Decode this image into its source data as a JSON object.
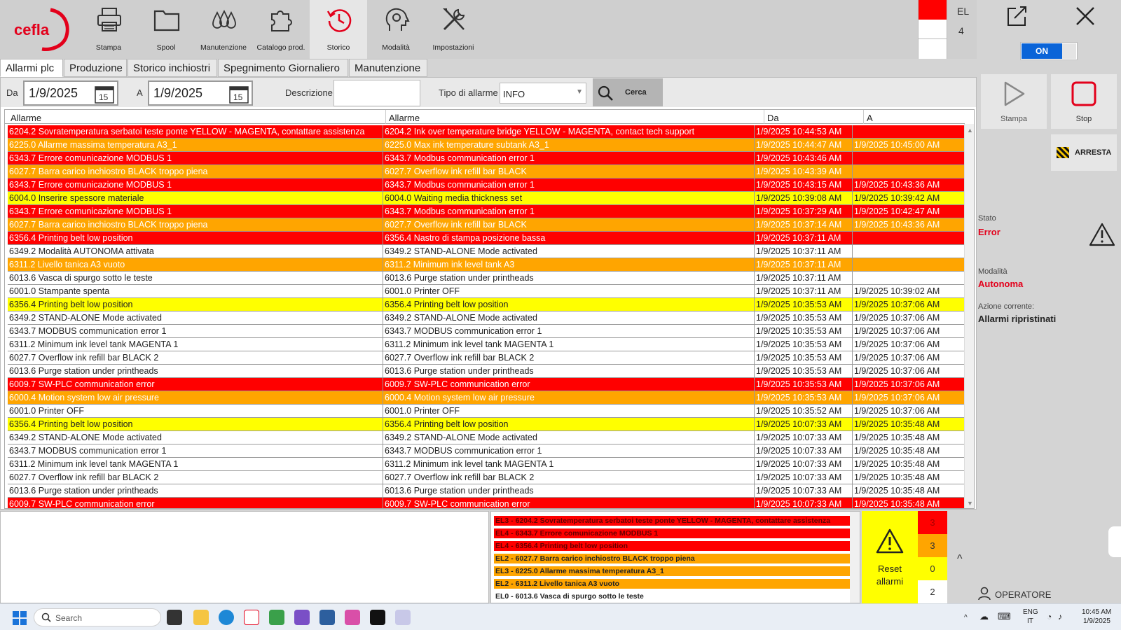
{
  "app": {
    "logo_text": "cefla",
    "toolbar": [
      {
        "id": "stampa",
        "label": "Stampa",
        "icon": "printer-icon"
      },
      {
        "id": "spool",
        "label": "Spool",
        "icon": "folder-icon"
      },
      {
        "id": "manutenzione",
        "label": "Manutenzione",
        "icon": "drops-icon"
      },
      {
        "id": "catalogo",
        "label": "Catalogo prod.",
        "icon": "puzzle-icon"
      },
      {
        "id": "storico",
        "label": "Storico",
        "icon": "history-icon",
        "active": true
      },
      {
        "id": "modalita",
        "label": "Modalità",
        "icon": "gear-head-icon"
      },
      {
        "id": "impostazioni",
        "label": "Impostazioni",
        "icon": "tools-icon"
      }
    ],
    "el_label": "EL",
    "el_value": "4"
  },
  "tabs": [
    {
      "label": "Allarmi plc",
      "active": true
    },
    {
      "label": "Produzione"
    },
    {
      "label": "Storico inchiostri"
    },
    {
      "label": "Spegnimento Giornaliero"
    },
    {
      "label": "Manutenzione"
    }
  ],
  "filter": {
    "da_label": "Da",
    "da_value": "1/9/2025",
    "a_label": "A",
    "a_value": "1/9/2025",
    "calendar_day": "15",
    "descrizione_label": "Descrizione",
    "descrizione_value": "",
    "tipo_label": "Tipo di allarme",
    "tipo_value": "INFO",
    "cerca_label": "Cerca"
  },
  "grid": {
    "headers": [
      "Allarme",
      "Allarme",
      "Da",
      "A"
    ],
    "rows": [
      {
        "c": "red",
        "it": "6204.2  Sovratemperatura serbatoi teste ponte YELLOW - MAGENTA, contattare assistenza",
        "en": "6204.2  Ink over temperature bridge YELLOW - MAGENTA, contact tech support",
        "da": "1/9/2025 10:44:53 AM",
        "a": ""
      },
      {
        "c": "orange",
        "it": "6225.0   Allarme massima temperatura A3_1",
        "en": "6225.0   Max ink temperature subtank A3_1",
        "da": "1/9/2025 10:44:47 AM",
        "a": "1/9/2025 10:45:00 AM"
      },
      {
        "c": "red",
        "it": "6343.7   Errore comunicazione MODBUS 1",
        "en": "6343.7   Modbus communication error 1",
        "da": "1/9/2025 10:43:46 AM",
        "a": ""
      },
      {
        "c": "orange",
        "it": "6027.7   Barra carico inchiostro BLACK troppo piena",
        "en": "6027.7   Overflow ink refill bar BLACK",
        "da": "1/9/2025 10:43:39 AM",
        "a": ""
      },
      {
        "c": "red",
        "it": "6343.7   Errore comunicazione MODBUS 1",
        "en": "6343.7   Modbus communication error 1",
        "da": "1/9/2025 10:43:15 AM",
        "a": "1/9/2025 10:43:36 AM"
      },
      {
        "c": "yellow",
        "it": "6004.0  Inserire spessore materiale",
        "en": "6004.0  Waiting media thickness set",
        "da": "1/9/2025 10:39:08 AM",
        "a": "1/9/2025 10:39:42 AM"
      },
      {
        "c": "red",
        "it": "6343.7   Errore comunicazione MODBUS 1",
        "en": "6343.7   Modbus communication error 1",
        "da": "1/9/2025 10:37:29 AM",
        "a": "1/9/2025 10:42:47 AM"
      },
      {
        "c": "orange",
        "it": "6027.7   Barra carico inchiostro BLACK troppo piena",
        "en": "6027.7   Overflow ink refill bar BLACK",
        "da": "1/9/2025 10:37:14 AM",
        "a": "1/9/2025 10:43:36 AM"
      },
      {
        "c": "red",
        "it": "6356.4 Printing belt low position",
        "en": "6356.4 Nastro di stampa posizione bassa",
        "da": "1/9/2025 10:37:11 AM",
        "a": ""
      },
      {
        "c": "white",
        "it": "6349.2   Modalità AUTONOMA attivata",
        "en": "6349.2   STAND-ALONE Mode activated",
        "da": "1/9/2025 10:37:11 AM",
        "a": ""
      },
      {
        "c": "orange",
        "it": "6311.2   Livello tanica A3 vuoto",
        "en": "6311.2   Minimum ink level tank A3",
        "da": "1/9/2025 10:37:11 AM",
        "a": ""
      },
      {
        "c": "white",
        "it": "6013.6   Vasca di spurgo sotto le teste",
        "en": "6013.6   Purge station under printheads",
        "da": "1/9/2025 10:37:11 AM",
        "a": ""
      },
      {
        "c": "white",
        "it": "6001.0   Stampante spenta",
        "en": "6001.0   Printer OFF",
        "da": "1/9/2025 10:37:11 AM",
        "a": "1/9/2025 10:39:02 AM"
      },
      {
        "c": "yellow",
        "it": "6356.4 Printing belt low position",
        "en": "6356.4 Printing belt low position",
        "da": "1/9/2025 10:35:53 AM",
        "a": "1/9/2025 10:37:06 AM"
      },
      {
        "c": "white",
        "it": "6349.2  STAND-ALONE Mode activated",
        "en": "6349.2  STAND-ALONE Mode activated",
        "da": "1/9/2025 10:35:53 AM",
        "a": "1/9/2025 10:37:06 AM"
      },
      {
        "c": "white",
        "it": "6343.7  MODBUS communication error 1",
        "en": "6343.7  MODBUS communication error 1",
        "da": "1/9/2025 10:35:53 AM",
        "a": "1/9/2025 10:37:06 AM"
      },
      {
        "c": "white",
        "it": "6311.2  Minimum ink level tank MAGENTA 1",
        "en": "6311.2  Minimum ink level tank MAGENTA 1",
        "da": "1/9/2025 10:35:53 AM",
        "a": "1/9/2025 10:37:06 AM"
      },
      {
        "c": "white",
        "it": "6027.7  Overflow ink refill bar BLACK 2",
        "en": "6027.7  Overflow ink refill bar BLACK 2",
        "da": "1/9/2025 10:35:53 AM",
        "a": "1/9/2025 10:37:06 AM"
      },
      {
        "c": "white",
        "it": "6013.6  Purge station under printheads",
        "en": "6013.6  Purge station under printheads",
        "da": "1/9/2025 10:35:53 AM",
        "a": "1/9/2025 10:37:06 AM"
      },
      {
        "c": "red",
        "it": "6009.7  SW-PLC communication error",
        "en": "6009.7  SW-PLC communication error",
        "da": "1/9/2025 10:35:53 AM",
        "a": "1/9/2025 10:37:06 AM"
      },
      {
        "c": "orange",
        "it": "6000.4 Motion system low air pressure",
        "en": "6000.4 Motion system low air pressure",
        "da": "1/9/2025 10:35:53 AM",
        "a": "1/9/2025 10:37:06 AM"
      },
      {
        "c": "white",
        "it": "6001.0  Printer OFF",
        "en": "6001.0  Printer OFF",
        "da": "1/9/2025 10:35:52 AM",
        "a": "1/9/2025 10:37:06 AM"
      },
      {
        "c": "yellow",
        "it": "6356.4 Printing belt low position",
        "en": "6356.4 Printing belt low position",
        "da": "1/9/2025 10:07:33 AM",
        "a": "1/9/2025 10:35:48 AM"
      },
      {
        "c": "white",
        "it": "6349.2  STAND-ALONE Mode activated",
        "en": "6349.2  STAND-ALONE Mode activated",
        "da": "1/9/2025 10:07:33 AM",
        "a": "1/9/2025 10:35:48 AM"
      },
      {
        "c": "white",
        "it": "6343.7  MODBUS communication error 1",
        "en": "6343.7  MODBUS communication error 1",
        "da": "1/9/2025 10:07:33 AM",
        "a": "1/9/2025 10:35:48 AM"
      },
      {
        "c": "white",
        "it": "6311.2  Minimum ink level tank MAGENTA 1",
        "en": "6311.2  Minimum ink level tank MAGENTA 1",
        "da": "1/9/2025 10:07:33 AM",
        "a": "1/9/2025 10:35:48 AM"
      },
      {
        "c": "white",
        "it": "6027.7  Overflow ink refill bar BLACK 2",
        "en": "6027.7  Overflow ink refill bar BLACK 2",
        "da": "1/9/2025 10:07:33 AM",
        "a": "1/9/2025 10:35:48 AM"
      },
      {
        "c": "white",
        "it": "6013.6  Purge station under printheads",
        "en": "6013.6  Purge station under printheads",
        "da": "1/9/2025 10:07:33 AM",
        "a": "1/9/2025 10:35:48 AM"
      },
      {
        "c": "red",
        "it": "6009.7  SW-PLC communication error",
        "en": "6009.7  SW-PLC communication error",
        "da": "1/9/2025 10:07:33 AM",
        "a": "1/9/2025 10:35:48 AM"
      }
    ]
  },
  "active_alarms": [
    {
      "c": "red",
      "text": "EL3 - 6204.2  Sovratemperatura serbatoi teste ponte YELLOW - MAGENTA, contattare assistenza"
    },
    {
      "c": "red",
      "text": "EL4 - 6343.7   Errore comunicazione MODBUS 1"
    },
    {
      "c": "red",
      "text": "EL4 - 6356.4 Printing belt low position"
    },
    {
      "c": "orange",
      "text": "EL2 - 6027.7   Barra carico inchiostro BLACK troppo piena"
    },
    {
      "c": "orange",
      "text": "EL3 - 6225.0   Allarme massima temperatura A3_1"
    },
    {
      "c": "orange",
      "text": "EL2 - 6311.2   Livello tanica A3 vuoto"
    },
    {
      "c": "white",
      "text": "EL0 - 6013.6   Vasca di spurgo sotto le teste"
    }
  ],
  "reset": {
    "label_1": "Reset",
    "label_2": "allarmi"
  },
  "counts": [
    {
      "value": "3",
      "color": "#ff0000"
    },
    {
      "value": "3",
      "color": "#ffa500"
    },
    {
      "value": "0",
      "color": "#ffff00"
    },
    {
      "value": "2",
      "color": "#ffffff"
    }
  ],
  "right": {
    "toggle_label": "ON",
    "stampa_label": "Stampa",
    "stop_label": "Stop",
    "arresta_label": "ARRESTA",
    "stato_label": "Stato",
    "stato_value": "Error",
    "modalita_label": "Modalità",
    "modalita_value": "Autonoma",
    "azione_label": "Azione corrente:",
    "azione_value": "Allarmi ripristinati",
    "operatore_label": "OPERATORE"
  },
  "taskbar": {
    "search_placeholder": "Search",
    "lang_1": "ENG",
    "lang_2": "IT",
    "time": "10:45 AM",
    "date": "1/9/2025"
  },
  "colors": {
    "red": "#ff0000",
    "orange": "#ffa500",
    "yellow": "#ffff00",
    "accent_blue": "#0a64d8",
    "brand_red": "#e3001b"
  }
}
